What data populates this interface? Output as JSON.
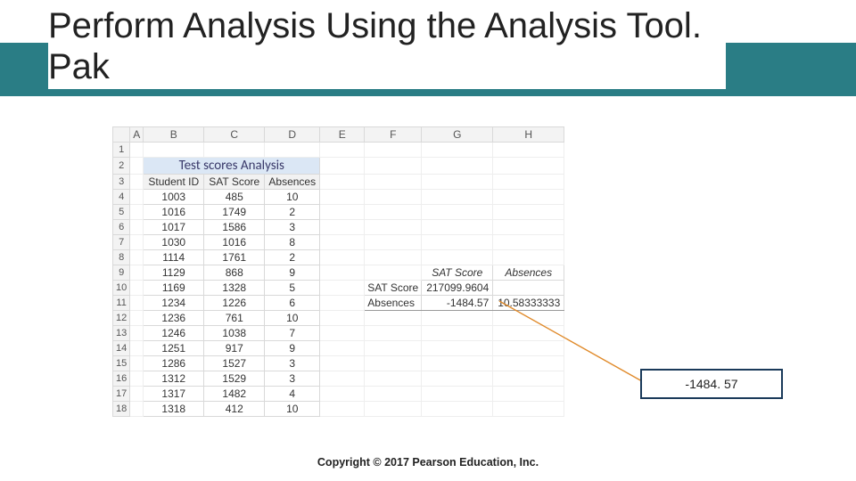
{
  "title": "Perform Analysis Using the Analysis Tool. Pak",
  "footer": "Copyright © 2017 Pearson Education, Inc.",
  "callout_value": "-1484. 57",
  "sheet": {
    "col_letters": [
      "A",
      "B",
      "C",
      "D",
      "E",
      "F",
      "G",
      "H"
    ],
    "row_numbers": [
      1,
      2,
      3,
      4,
      5,
      6,
      7,
      8,
      9,
      10,
      11,
      12,
      13,
      14,
      15,
      16,
      17,
      18
    ],
    "merged_title": "Test scores Analysis",
    "headers": {
      "b": "Student ID",
      "c": "SAT Score",
      "d": "Absences"
    },
    "rows": [
      {
        "id": 1003,
        "sat": 485,
        "abs": 10
      },
      {
        "id": 1016,
        "sat": 1749,
        "abs": 2
      },
      {
        "id": 1017,
        "sat": 1586,
        "abs": 3
      },
      {
        "id": 1030,
        "sat": 1016,
        "abs": 8
      },
      {
        "id": 1114,
        "sat": 1761,
        "abs": 2
      },
      {
        "id": 1129,
        "sat": 868,
        "abs": 9
      },
      {
        "id": 1169,
        "sat": 1328,
        "abs": 5
      },
      {
        "id": 1234,
        "sat": 1226,
        "abs": 6
      },
      {
        "id": 1236,
        "sat": 761,
        "abs": 10
      },
      {
        "id": 1246,
        "sat": 1038,
        "abs": 7
      },
      {
        "id": 1251,
        "sat": 917,
        "abs": 9
      },
      {
        "id": 1286,
        "sat": 1527,
        "abs": 3
      },
      {
        "id": 1312,
        "sat": 1529,
        "abs": 3
      },
      {
        "id": 1317,
        "sat": 1482,
        "abs": 4
      },
      {
        "id": 1318,
        "sat": 412,
        "abs": 10
      }
    ],
    "covariance": {
      "col_g_header": "SAT  Score",
      "col_h_header": "Absences",
      "row1_label": "SAT  Score",
      "row1_g": "217099.9604",
      "row2_label": "Absences",
      "row2_g": "-1484.57",
      "row2_h": "10.58333333"
    }
  },
  "chart_data": {
    "type": "table",
    "title": "Test scores Analysis",
    "columns": [
      "Student ID",
      "SAT Score",
      "Absences"
    ],
    "rows": [
      [
        1003,
        485,
        10
      ],
      [
        1016,
        1749,
        2
      ],
      [
        1017,
        1586,
        3
      ],
      [
        1030,
        1016,
        8
      ],
      [
        1114,
        1761,
        2
      ],
      [
        1129,
        868,
        9
      ],
      [
        1169,
        1328,
        5
      ],
      [
        1234,
        1226,
        6
      ],
      [
        1236,
        761,
        10
      ],
      [
        1246,
        1038,
        7
      ],
      [
        1251,
        917,
        9
      ],
      [
        1286,
        1527,
        3
      ],
      [
        1312,
        1529,
        3
      ],
      [
        1317,
        1482,
        4
      ],
      [
        1318,
        412,
        10
      ]
    ],
    "covariance_matrix": {
      "labels": [
        "SAT Score",
        "Absences"
      ],
      "values": [
        [
          217099.9604,
          null
        ],
        [
          -1484.57,
          10.58333333
        ]
      ]
    }
  }
}
